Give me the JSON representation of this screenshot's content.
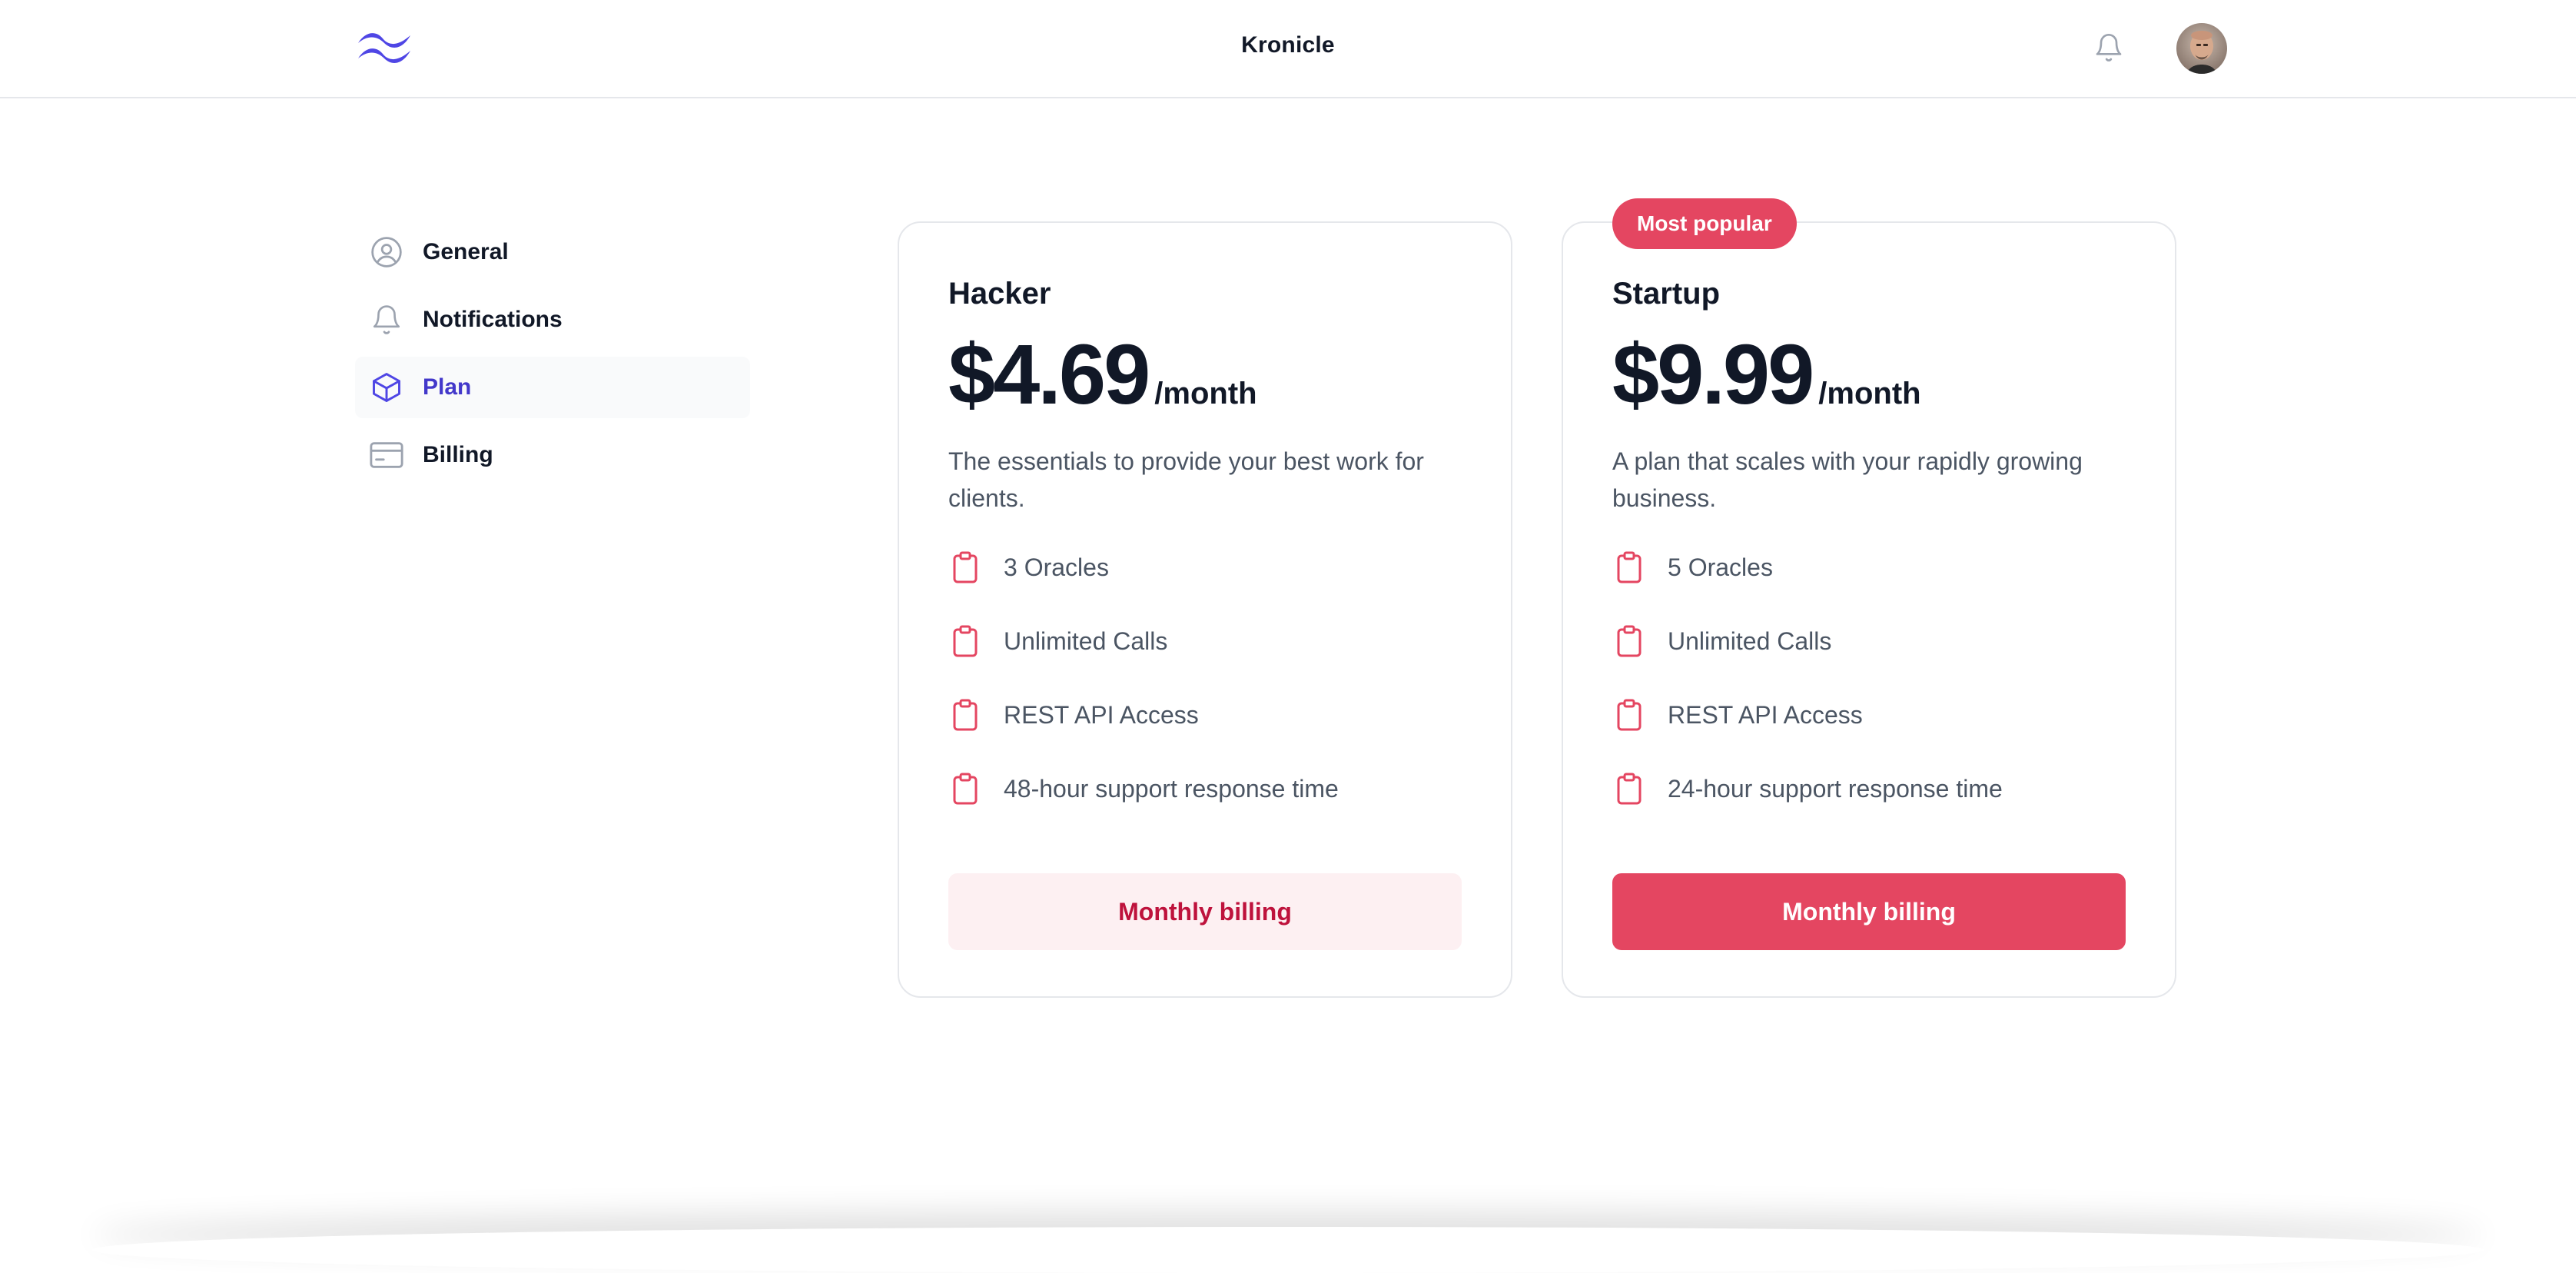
{
  "header": {
    "app_title": "Kronicle",
    "logo_icon": "wave-logo-icon",
    "notifications_icon": "bell-icon",
    "avatar": "user-avatar"
  },
  "sidebar": {
    "items": [
      {
        "label": "General",
        "icon": "user-circle-icon",
        "active": false
      },
      {
        "label": "Notifications",
        "icon": "bell-icon",
        "active": false
      },
      {
        "label": "Plan",
        "icon": "cube-icon",
        "active": true
      },
      {
        "label": "Billing",
        "icon": "credit-card-icon",
        "active": false
      }
    ]
  },
  "plans": [
    {
      "name": "Hacker",
      "price": "$4.69",
      "period": "/month",
      "description": "The essentials to provide your best work for clients.",
      "features": [
        "3 Oracles",
        "Unlimited Calls",
        "REST API Access",
        "48-hour support response time"
      ],
      "cta": "Monthly billing",
      "badge": null
    },
    {
      "name": "Startup",
      "price": "$9.99",
      "period": "/month",
      "description": "A plan that scales with your rapidly growing business.",
      "features": [
        "5 Oracles",
        "Unlimited Calls",
        "REST API Access",
        "24-hour support response time"
      ],
      "cta": "Monthly billing",
      "badge": "Most popular"
    }
  ],
  "colors": {
    "accent": "#e44661",
    "accent_light": "#fdf0f2",
    "nav_active": "#4338ca",
    "logo": "#4f46e5"
  }
}
